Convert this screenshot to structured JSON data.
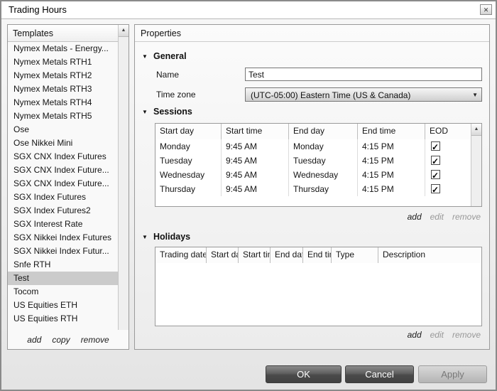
{
  "window": {
    "title": "Trading Hours"
  },
  "icons": {
    "close": "✕",
    "up_arrow": "▲",
    "down_arrow": "▼",
    "section_expanded": "▼"
  },
  "templates": {
    "header": "Templates",
    "items": [
      "Nymex Metals - Energy...",
      "Nymex Metals RTH1",
      "Nymex Metals RTH2",
      "Nymex Metals RTH3",
      "Nymex Metals RTH4",
      "Nymex Metals RTH5",
      "Ose",
      "Ose Nikkei Mini",
      "SGX CNX Index Futures",
      "SGX CNX Index Future...",
      "SGX CNX Index Future...",
      "SGX Index Futures",
      "SGX Index Futures2",
      "SGX Interest Rate",
      "SGX Nikkei Index Futures",
      "SGX Nikkei Index Futur...",
      "Snfe RTH",
      "Test",
      "Tocom",
      "US Equities ETH",
      "US Equities RTH"
    ],
    "selected_item": "Test",
    "actions": {
      "add": "add",
      "copy": "copy",
      "remove": "remove"
    }
  },
  "properties": {
    "header": "Properties",
    "general": {
      "section_label": "General",
      "name_label": "Name",
      "name_value": "Test",
      "timezone_label": "Time zone",
      "timezone_value": "(UTC-05:00) Eastern Time (US & Canada)"
    },
    "sessions": {
      "section_label": "Sessions",
      "columns": {
        "start_day": "Start day",
        "start_time": "Start time",
        "end_day": "End day",
        "end_time": "End time",
        "eod": "EOD"
      },
      "rows": [
        {
          "start_day": "Monday",
          "start_time": "9:45 AM",
          "end_day": "Monday",
          "end_time": "4:15 PM",
          "eod": true
        },
        {
          "start_day": "Tuesday",
          "start_time": "9:45 AM",
          "end_day": "Tuesday",
          "end_time": "4:15 PM",
          "eod": true
        },
        {
          "start_day": "Wednesday",
          "start_time": "9:45 AM",
          "end_day": "Wednesday",
          "end_time": "4:15 PM",
          "eod": true
        },
        {
          "start_day": "Thursday",
          "start_time": "9:45 AM",
          "end_day": "Thursday",
          "end_time": "4:15 PM",
          "eod": true
        }
      ],
      "actions": {
        "add": "add",
        "edit": "edit",
        "remove": "remove"
      }
    },
    "holidays": {
      "section_label": "Holidays",
      "columns": {
        "trading_date": "Trading date",
        "start_date": "Start date",
        "start_time": "Start time",
        "end_date": "End date",
        "end_time": "End time",
        "type": "Type",
        "description": "Description"
      },
      "rows": [],
      "actions": {
        "add": "add",
        "edit": "edit",
        "remove": "remove"
      }
    }
  },
  "footer": {
    "ok": "OK",
    "cancel": "Cancel",
    "apply": "Apply"
  }
}
